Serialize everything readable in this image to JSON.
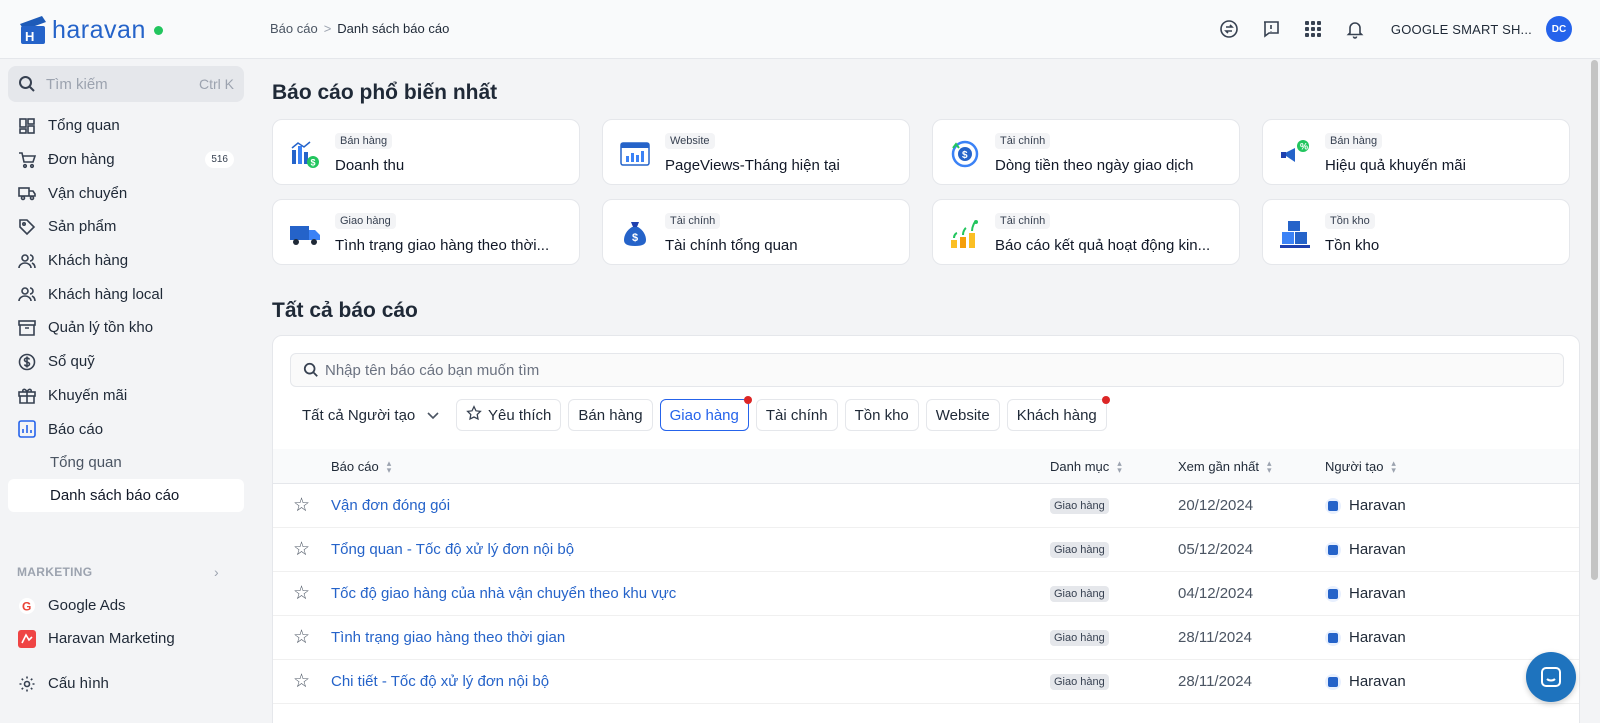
{
  "brand": {
    "name": "haravan"
  },
  "breadcrumb": {
    "parent": "Báo cáo",
    "separator": ">",
    "current": "Danh sách báo cáo"
  },
  "header": {
    "shop_name": "GOOGLE SMART SH...",
    "avatar_initials": "DC"
  },
  "sidebar": {
    "search": {
      "placeholder": "Tìm kiếm",
      "shortcut": "Ctrl K"
    },
    "items": [
      {
        "label": "Tổng quan",
        "icon": "dashboard-icon"
      },
      {
        "label": "Đơn hàng",
        "icon": "cart-icon",
        "count": "516"
      },
      {
        "label": "Vận chuyển",
        "icon": "truck-icon"
      },
      {
        "label": "Sản phẩm",
        "icon": "tag-icon"
      },
      {
        "label": "Khách hàng",
        "icon": "users-icon"
      },
      {
        "label": "Khách hàng local",
        "icon": "users-icon"
      },
      {
        "label": "Quản lý tồn kho",
        "icon": "archive-icon"
      },
      {
        "label": "Sổ quỹ",
        "icon": "dollar-icon"
      },
      {
        "label": "Khuyến mãi",
        "icon": "gift-icon"
      },
      {
        "label": "Báo cáo",
        "icon": "chart-icon"
      }
    ],
    "sub_items": [
      {
        "label": "Tổng quan"
      },
      {
        "label": "Danh sách báo cáo"
      }
    ],
    "marketing_label": "MARKETING",
    "marketing_items": [
      {
        "label": "Google Ads",
        "icon": "google-icon"
      },
      {
        "label": "Haravan Marketing",
        "icon": "haravan-marketing-icon"
      }
    ],
    "settings_label": "Cấu hình"
  },
  "popular": {
    "title": "Báo cáo phổ biến nhất",
    "cards": [
      {
        "tag": "Bán hàng",
        "title": "Doanh thu",
        "icon": "revenue-chart-icon"
      },
      {
        "tag": "Website",
        "title": "PageViews-Tháng hiện tại",
        "icon": "web-analytics-icon"
      },
      {
        "tag": "Tài chính",
        "title": "Dòng tiền theo ngày giao dịch",
        "icon": "cashflow-icon"
      },
      {
        "tag": "Bán hàng",
        "title": "Hiệu quả khuyến mãi",
        "icon": "promotion-icon"
      },
      {
        "tag": "Giao hàng",
        "title": "Tình trạng giao hàng theo thời...",
        "icon": "delivery-truck-icon"
      },
      {
        "tag": "Tài chính",
        "title": "Tài chính tổng quan",
        "icon": "money-bag-icon"
      },
      {
        "tag": "Tài chính",
        "title": "Báo cáo kết quả hoạt động kin...",
        "icon": "growth-plant-icon"
      },
      {
        "tag": "Tồn kho",
        "title": "Tồn kho",
        "icon": "inventory-boxes-icon"
      }
    ]
  },
  "all_reports": {
    "title": "Tất cả báo cáo",
    "search_placeholder": "Nhập tên báo cáo bạn muốn tìm",
    "creator_filter": "Tất cả Người tạo",
    "chips": [
      {
        "label": "Yêu thích",
        "icon": "star-icon",
        "active": false,
        "dot": false
      },
      {
        "label": "Bán hàng",
        "active": false,
        "dot": false
      },
      {
        "label": "Giao hàng",
        "active": true,
        "dot": true
      },
      {
        "label": "Tài chính",
        "active": false,
        "dot": false
      },
      {
        "label": "Tồn kho",
        "active": false,
        "dot": false
      },
      {
        "label": "Website",
        "active": false,
        "dot": false
      },
      {
        "label": "Khách hàng",
        "active": false,
        "dot": true
      }
    ],
    "columns": {
      "name": "Báo cáo",
      "category": "Danh mục",
      "last_viewed": "Xem gần nhất",
      "creator": "Người tạo"
    },
    "rows": [
      {
        "name": "Vận đơn đóng gói",
        "category": "Giao hàng",
        "last_viewed": "20/12/2024",
        "creator": "Haravan"
      },
      {
        "name": "Tổng quan - Tốc độ xử lý đơn nội bộ",
        "category": "Giao hàng",
        "last_viewed": "05/12/2024",
        "creator": "Haravan"
      },
      {
        "name": "Tốc độ giao hàng của nhà vận chuyển theo khu vực",
        "category": "Giao hàng",
        "last_viewed": "04/12/2024",
        "creator": "Haravan"
      },
      {
        "name": "Tình trạng giao hàng theo thời gian",
        "category": "Giao hàng",
        "last_viewed": "28/11/2024",
        "creator": "Haravan"
      },
      {
        "name": "Chi tiết - Tốc độ xử lý đơn nội bộ",
        "category": "Giao hàng",
        "last_viewed": "28/11/2024",
        "creator": "Haravan"
      }
    ]
  },
  "colors": {
    "brand": "#2563c9",
    "active": "#2563eb",
    "online": "#22c55e",
    "badge_dot": "#dc2626"
  }
}
